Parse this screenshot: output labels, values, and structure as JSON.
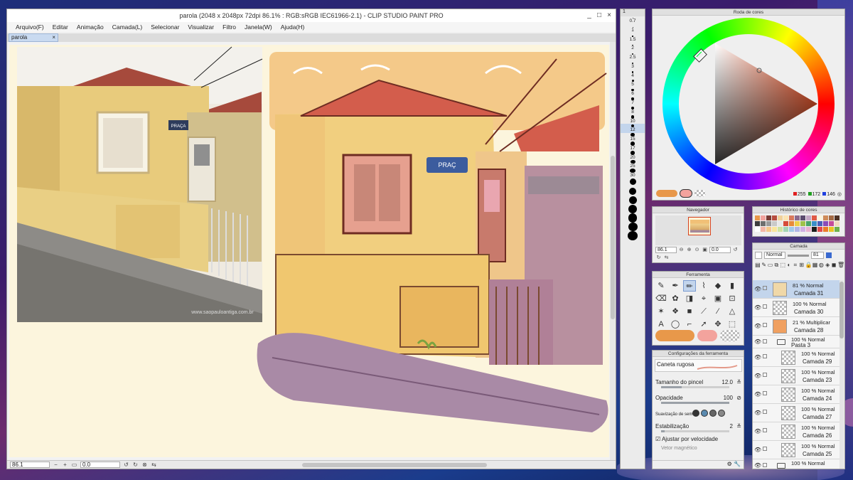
{
  "window": {
    "title": "parola (2048 x 2048px 72dpi 86.1% : RGB:sRGB IEC61966-2.1) - CLIP STUDIO PAINT PRO",
    "minimize": "_",
    "maximize": "□",
    "close": "×"
  },
  "menu": [
    "Arquivo(F)",
    "Editar",
    "Animação",
    "Camada(L)",
    "Selecionar",
    "Visualizar",
    "Filtro",
    "Janela(W)",
    "Ajuda(H)"
  ],
  "tab": {
    "name": "parola",
    "close": "×"
  },
  "photo": {
    "sign": "PRAÇA",
    "watermark": "www.saopauloantiga.com.br"
  },
  "painting": {
    "sign": "PRAÇ"
  },
  "status": {
    "zoom": "86.1",
    "rotation": "0.0"
  },
  "brush_size": {
    "header": "1",
    "values": [
      "0.7",
      "1",
      "1.5",
      "2",
      "2.5",
      "3",
      "4",
      "5",
      "6",
      "7",
      "8",
      "10",
      "12",
      "15",
      "17",
      "20",
      "25",
      "30",
      "40",
      "50",
      "60",
      "70",
      "80",
      "100",
      "120"
    ],
    "dot_sizes": [
      1,
      1,
      1.3,
      1.6,
      2,
      2.2,
      2.6,
      3,
      3.3,
      3.6,
      4,
      4.4,
      4.8,
      5.2,
      5.6,
      6.2,
      7,
      8,
      9,
      10,
      11,
      12,
      12.5,
      13,
      13.5
    ],
    "selected": "12"
  },
  "color_wheel": {
    "title": "Roda de cores",
    "r": "255",
    "g": "172",
    "b": "146",
    "main_color": "#e8984a",
    "sub_color": "#f3a39d",
    "triangle_color": "#ff5a2a"
  },
  "navigator": {
    "title": "Navegador",
    "zoom": "86.1",
    "angle": "0.0"
  },
  "color_history": {
    "title": "Histórico de cores",
    "colors": [
      "#e8984a",
      "#f3a39d",
      "#7a3b35",
      "#b74d3f",
      "#f1d19a",
      "#fbe4b2",
      "#d97a5d",
      "#8b6a8d",
      "#5b4b6e",
      "#c3a7c5",
      "#e05a45",
      "#fcf5dd",
      "#cf8b59",
      "#a56b45",
      "#4f3326",
      "#3d3d3d",
      "#6e6e6e",
      "#9a9a9a",
      "#c9c9c9",
      "#e9e9e9",
      "#d64b3a",
      "#e88a3a",
      "#edd048",
      "#9fc24b",
      "#4aa56b",
      "#3a8fc9",
      "#4b5fb8",
      "#8a4bb8",
      "#c44b9a",
      "#f0d9c0",
      "#ffffff",
      "#f4b6a6",
      "#f6c78a",
      "#f9e59c",
      "#cfe3a1",
      "#a3d4b4",
      "#a2c9e9",
      "#b1b5e6",
      "#d0b0e4",
      "#eab2d2",
      "#1c1c1c",
      "#e24c4c",
      "#eb7b2a",
      "#e9c424",
      "#6cb34c"
    ]
  },
  "tools": {
    "title": "Ferramenta",
    "icons": [
      "pen-icon",
      "brush-icon",
      "pen-nib-icon",
      "pencil-icon",
      "fill-bucket-icon",
      "eraser-icon",
      "eraser-pen-icon",
      "blend-icon",
      "gradient-icon",
      "color-pick-icon",
      "selection-icon",
      "lasso-icon",
      "sparkle-icon",
      "drop-icon",
      "square-icon",
      "line-icon",
      "brush2-icon",
      "figure-icon",
      "text-icon",
      "balloon-icon",
      "ruler-icon",
      "arrow-icon",
      "move-icon",
      "rect-select-icon"
    ],
    "glyphs": [
      "✎",
      "✒",
      "✏",
      "⌇",
      "◆",
      "▮",
      "⌫",
      "✿",
      "◨",
      "⌖",
      "▣",
      "⊡",
      "✶",
      "❖",
      "■",
      "⟋",
      "∕",
      "△",
      "A",
      "◯",
      "⌐",
      "➚",
      "✥",
      "⬚"
    ],
    "active_index": 2
  },
  "tool_settings": {
    "title": "Configurações da ferramenta",
    "preset": "Caneta rugosa",
    "brush_size_label": "Tamanho do pincel",
    "brush_size_value": "12.0",
    "opacity_label": "Opacidade",
    "opacity_value": "100",
    "smoothing_label": "Suavização de sem",
    "stabilization_label": "Estabilização",
    "stabilization_value": "2",
    "speed_label": "Ajustar por velocidade",
    "vector_label": "Vetor magnético"
  },
  "layers": {
    "title": "Camada",
    "blend_mode": "Normal",
    "opacity": "81",
    "items": [
      {
        "blend": "81 % Normal",
        "name": "Camada 31",
        "type": "layer",
        "active": true,
        "thumb": "#f0d8a8",
        "indent": 0
      },
      {
        "blend": "100 % Normal",
        "name": "Camada 30",
        "type": "layer",
        "active": false,
        "thumb": "checker",
        "indent": 0
      },
      {
        "blend": "21 % Multiplicar",
        "name": "Camada 28",
        "type": "layer",
        "active": false,
        "thumb": "#f0a060",
        "indent": 0
      },
      {
        "blend": "100 % Normal",
        "name": "Pasta 3",
        "type": "folder",
        "active": false,
        "thumb": "",
        "indent": 0
      },
      {
        "blend": "100 % Normal",
        "name": "Camada 29",
        "type": "layer",
        "active": false,
        "thumb": "checker",
        "indent": 1
      },
      {
        "blend": "100 % Normal",
        "name": "Camada 23",
        "type": "layer",
        "active": false,
        "thumb": "checker",
        "indent": 1
      },
      {
        "blend": "100 % Normal",
        "name": "Camada 24",
        "type": "layer",
        "active": false,
        "thumb": "checker",
        "indent": 1
      },
      {
        "blend": "100 % Normal",
        "name": "Camada 27",
        "type": "layer",
        "active": false,
        "thumb": "checker",
        "indent": 1
      },
      {
        "blend": "100 % Normal",
        "name": "Camada 26",
        "type": "layer",
        "active": false,
        "thumb": "checker",
        "indent": 1
      },
      {
        "blend": "100 % Normal",
        "name": "Camada 25",
        "type": "layer",
        "active": false,
        "thumb": "checker",
        "indent": 1
      },
      {
        "blend": "100 % Normal",
        "name": "",
        "type": "folder",
        "active": false,
        "thumb": "",
        "indent": 0
      }
    ]
  }
}
